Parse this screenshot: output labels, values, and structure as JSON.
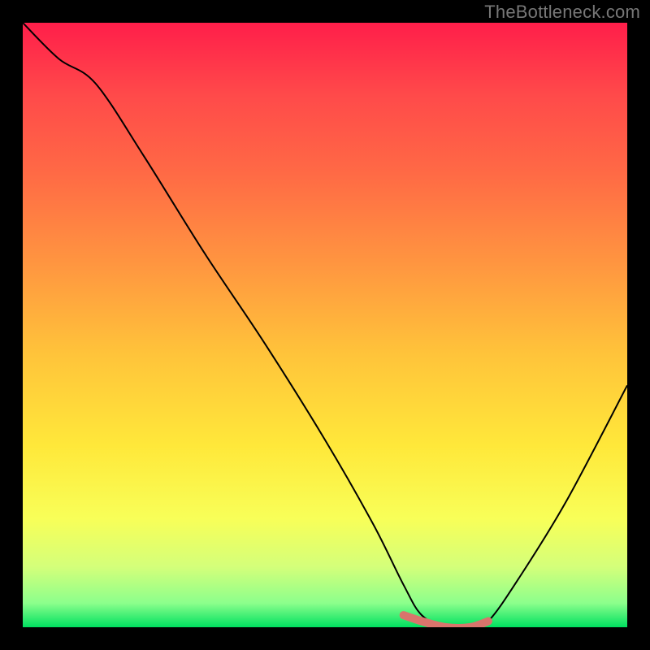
{
  "watermark": "TheBottleneck.com",
  "chart_data": {
    "type": "line",
    "title": "",
    "xlabel": "",
    "ylabel": "",
    "xlim": [
      0,
      100
    ],
    "ylim": [
      0,
      100
    ],
    "series": [
      {
        "name": "bottleneck-curve",
        "x": [
          0,
          6,
          12,
          20,
          30,
          40,
          50,
          58,
          63,
          66,
          70,
          74,
          77,
          82,
          90,
          100
        ],
        "values": [
          100,
          94,
          90,
          78,
          62,
          47,
          31,
          17,
          7,
          2,
          0,
          0,
          1,
          8,
          21,
          40
        ]
      },
      {
        "name": "optimal-range-highlight",
        "x": [
          63,
          66,
          70,
          74,
          77
        ],
        "values": [
          2,
          1,
          0,
          0,
          1
        ]
      }
    ],
    "optimal_range": {
      "start_pct": 63,
      "end_pct": 77
    },
    "colors": {
      "curve": "#000000",
      "highlight": "#d9746c",
      "gradient_top": "#ff1e4a",
      "gradient_mid": "#ffe03a",
      "gradient_bottom": "#00e060"
    }
  }
}
